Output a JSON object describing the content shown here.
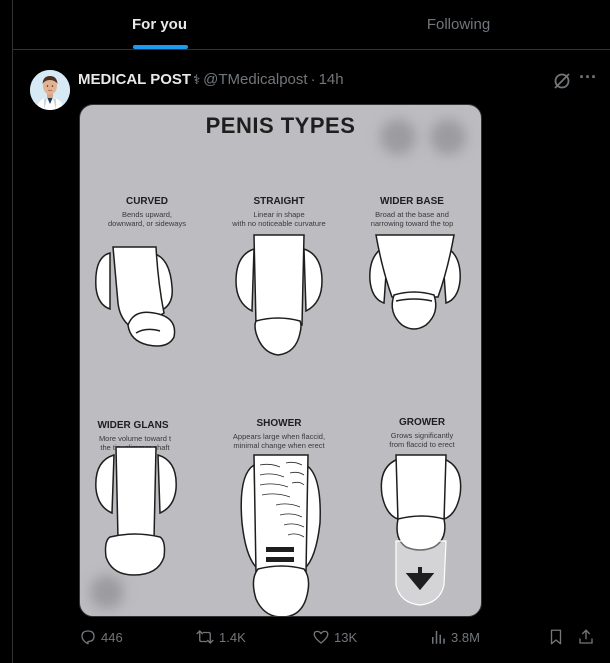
{
  "tabs": [
    {
      "label": "For you",
      "active": true
    },
    {
      "label": "Following",
      "active": false
    }
  ],
  "post": {
    "author_name": "MEDICAL POST",
    "badge_glyph": "⚕",
    "handle": "@TMedicalpost",
    "separator": "·",
    "time": "14h",
    "more_glyph": "···",
    "image": {
      "title": "PENIS TYPES",
      "types": [
        {
          "title": "CURVED",
          "desc": "Bends upward,\ndownward, or sideways"
        },
        {
          "title": "STRAIGHT",
          "desc": "Linear in shape\nwith no noticeable curvature"
        },
        {
          "title": "WIDER BASE",
          "desc": "Broad at the base and\nnarrowing toward the top"
        },
        {
          "title": "WIDER GLANS",
          "desc": "More volume toward t\nthe tip, slimmer shaft"
        },
        {
          "title": "SHOWER",
          "desc": "Appears large when flaccid,\nminimal change when erect"
        },
        {
          "title": "GROWER",
          "desc": "Grows significantly\nfrom flaccid to erect"
        }
      ]
    },
    "actions": {
      "replies": "446",
      "reposts": "1.4K",
      "likes": "13K",
      "views": "3.8M"
    }
  },
  "colors": {
    "background": "#000000",
    "border": "#2f3336",
    "accent": "#1d9bf0",
    "muted": "#71767b",
    "text": "#e7e9ea"
  },
  "icons": [
    "grok-icon",
    "more-icon",
    "reply-icon",
    "repost-icon",
    "like-icon",
    "views-icon",
    "bookmark-icon",
    "share-icon"
  ]
}
